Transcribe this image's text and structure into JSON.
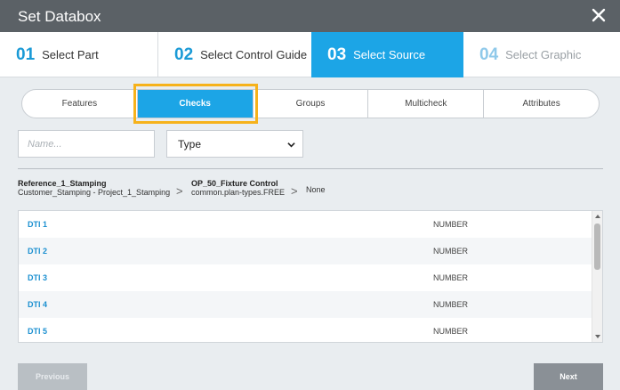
{
  "dialog": {
    "title": "Set Databox"
  },
  "steps": [
    {
      "num": "01",
      "label": "Select Part",
      "state": "done"
    },
    {
      "num": "02",
      "label": "Select Control Guide",
      "state": "done"
    },
    {
      "num": "03",
      "label": "Select Source",
      "state": "active"
    },
    {
      "num": "04",
      "label": "Select Graphic",
      "state": "disabled"
    }
  ],
  "tabs": [
    "Features",
    "Checks",
    "Groups",
    "Multicheck",
    "Attributes"
  ],
  "active_tab": "Checks",
  "filters": {
    "name_placeholder": "Name...",
    "type_value": "Type"
  },
  "breadcrumb": {
    "part_title": "Reference_1_Stamping",
    "part_sub": "Customer_Stamping - Project_1_Stamping",
    "guide_title": "OP_50_Fixture Control",
    "guide_sub": "common.plan-types.FREE",
    "source": "None"
  },
  "rows": [
    {
      "name": "DTI 1",
      "type": "NUMBER"
    },
    {
      "name": "DTI 2",
      "type": "NUMBER"
    },
    {
      "name": "DTI 3",
      "type": "NUMBER"
    },
    {
      "name": "DTI 4",
      "type": "NUMBER"
    },
    {
      "name": "DTI 5",
      "type": "NUMBER"
    }
  ],
  "buttons": {
    "previous": "Previous",
    "next": "Next"
  },
  "colors": {
    "accent": "#1ca5e6",
    "highlight": "#f6b21b",
    "titlebar": "#5b6166"
  },
  "icons": {
    "close": "close-icon",
    "select": "chevron-down-icon"
  }
}
